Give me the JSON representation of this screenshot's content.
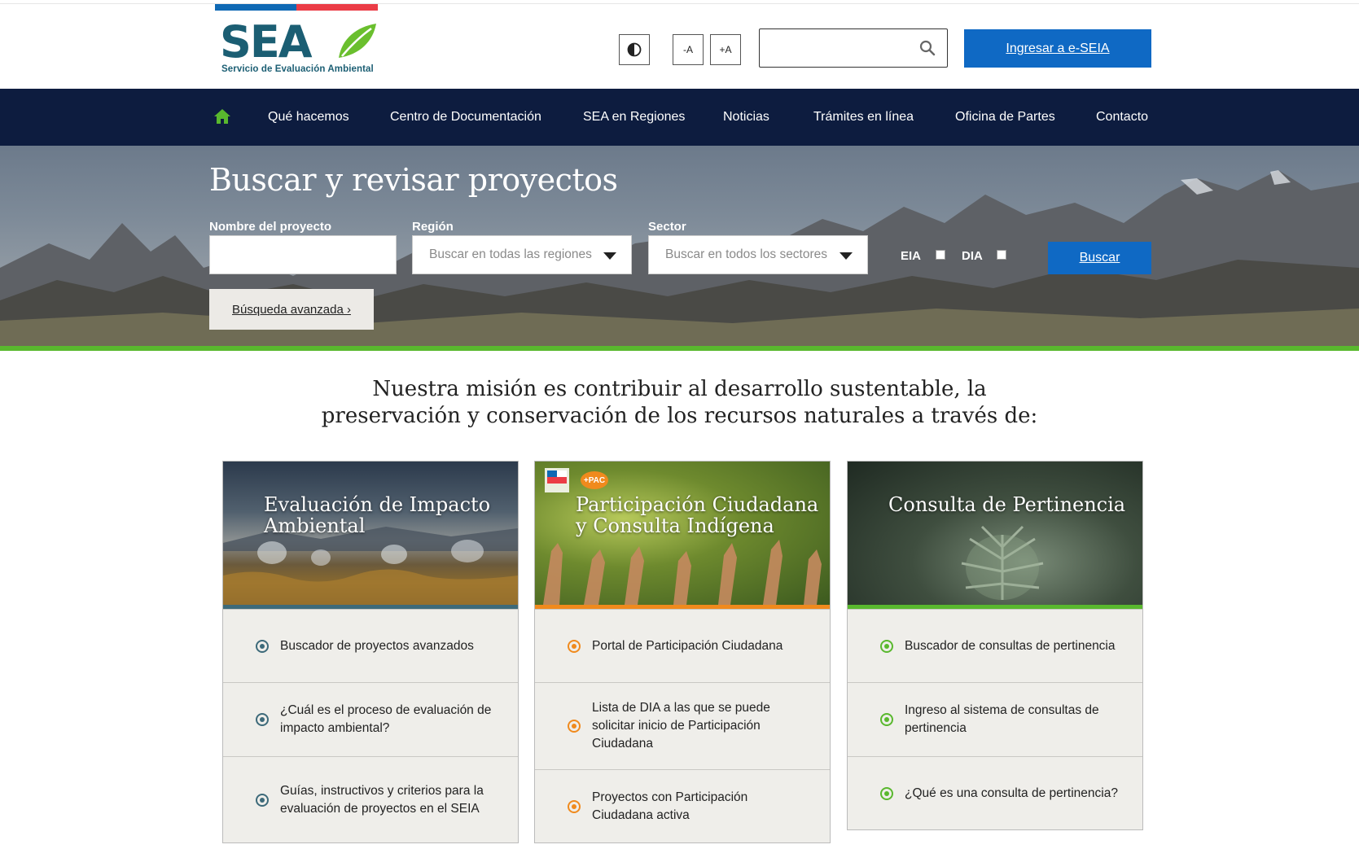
{
  "header": {
    "logo_text": "SEA",
    "logo_subtitle": "Servicio de Evaluación Ambiental",
    "font_small_label": "-A",
    "font_large_label": "+A",
    "search_placeholder": "",
    "eseia_label": "Ingresar a e-SEIA"
  },
  "nav": {
    "items": [
      {
        "label": "Qué hacemos"
      },
      {
        "label": "Centro de Documentación"
      },
      {
        "label": "SEA en Regiones"
      },
      {
        "label": "Noticias"
      },
      {
        "label": "Trámites en línea"
      },
      {
        "label": "Oficina de Partes"
      },
      {
        "label": "Contacto"
      }
    ]
  },
  "search": {
    "title": "Buscar y revisar proyectos",
    "name_label": "Nombre del proyecto",
    "name_value": "",
    "region_label": "Región",
    "region_value": "Buscar en todas las regiones",
    "sector_label": "Sector",
    "sector_value": "Buscar en todos los sectores",
    "eia_label": "EIA",
    "dia_label": "DIA",
    "submit_label": "Buscar",
    "advanced_label": "Búsqueda avanzada ›"
  },
  "mission": {
    "line1": "Nuestra misión es contribuir al desarrollo sustentable, la",
    "line2": "preservación y conservación de los recursos naturales a través de:"
  },
  "cards": [
    {
      "title": "Evaluación de Impacto Ambiental",
      "accent": "#3d6a7a",
      "items": [
        "Buscador de proyectos avanzados",
        "¿Cuál es el proceso de evaluación de impacto ambiental?",
        "Guías, instructivos y criterios para la evaluación de proyectos en el SEIA"
      ]
    },
    {
      "title": "Participación Ciudadana y Consulta Indígena",
      "badge": "+PAC",
      "accent": "#f08a1d",
      "items": [
        "Portal de Participación Ciudadana",
        "Lista de DIA a las que se puede solicitar inicio de Participación Ciudadana",
        "Proyectos con Participación Ciudadana activa"
      ]
    },
    {
      "title": "Consulta de Pertinencia",
      "accent": "#59b82e",
      "items": [
        "Buscador de consultas de pertinencia",
        "Ingreso al sistema de consultas de pertinencia",
        "¿Qué es una consulta de pertinencia?"
      ]
    }
  ],
  "colors": {
    "nav_bg": "#0d1c3f",
    "primary_blue": "#0f69c4",
    "green_accent": "#59b82e",
    "logo_teal": "#1b5e73"
  },
  "icons": {
    "home": "home-icon",
    "contrast": "contrast-icon",
    "search": "search-icon",
    "dropdown": "chevron-down-icon",
    "bullet": "circle-bullet-icon"
  }
}
